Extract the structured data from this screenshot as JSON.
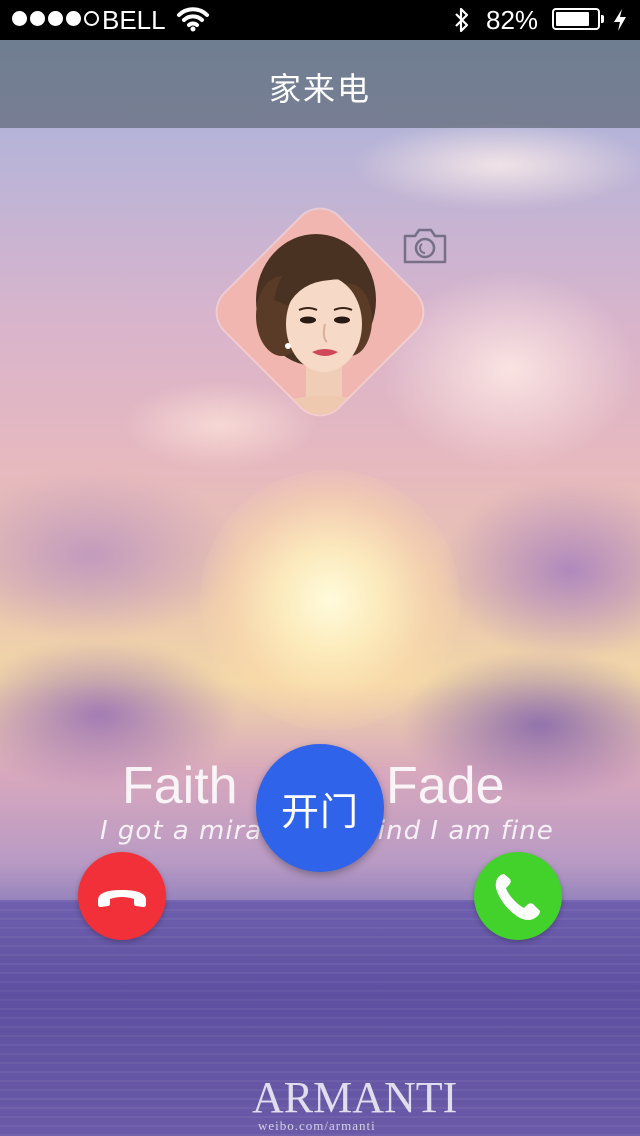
{
  "status_bar": {
    "carrier": "BELL",
    "signal_bars_filled": 4,
    "signal_bars_total": 5,
    "battery_percent": "82%",
    "battery_level": 0.82,
    "icons": [
      "wifi-icon",
      "bluetooth-icon",
      "charging-bolt-icon"
    ]
  },
  "header": {
    "title": "家来电"
  },
  "caller": {
    "avatar_icon": "caller-avatar-photo",
    "camera_icon": "camera-icon"
  },
  "wallpaper": {
    "title_left": "Faith",
    "title_right": "Fade",
    "subtitle": "I got a mirac        mind I am fine",
    "brand": "ARMANTI",
    "url": "weibo.com/armanti"
  },
  "actions": {
    "open_door_label": "开门",
    "decline_icon": "phone-hangup-icon",
    "accept_icon": "phone-accept-icon"
  },
  "colors": {
    "decline": "#f2303a",
    "accept": "#43d12c",
    "open_door": "#2f63ea",
    "status_bar_bg": "#000000"
  }
}
